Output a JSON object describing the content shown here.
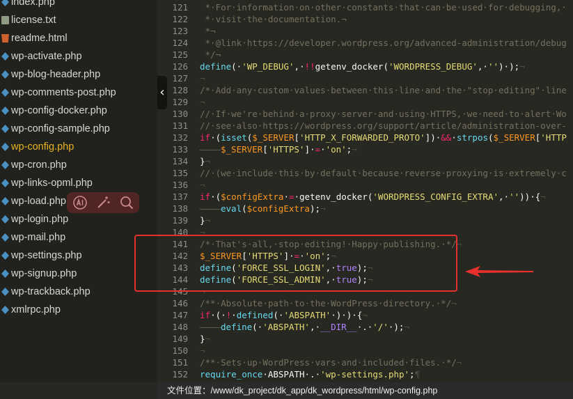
{
  "sidebar": {
    "files": [
      {
        "name": "index.php",
        "icon": "php-file-icon"
      },
      {
        "name": "license.txt",
        "icon": "txt-file-icon"
      },
      {
        "name": "readme.html",
        "icon": "html-file-icon"
      },
      {
        "name": "wp-activate.php",
        "icon": "php-file-icon"
      },
      {
        "name": "wp-blog-header.php",
        "icon": "php-file-icon"
      },
      {
        "name": "wp-comments-post.php",
        "icon": "php-file-icon"
      },
      {
        "name": "wp-config-docker.php",
        "icon": "php-file-icon"
      },
      {
        "name": "wp-config-sample.php",
        "icon": "php-file-icon"
      },
      {
        "name": "wp-config.php",
        "icon": "php-file-icon",
        "active": true
      },
      {
        "name": "wp-cron.php",
        "icon": "php-file-icon"
      },
      {
        "name": "wp-links-opml.php",
        "icon": "php-file-icon"
      },
      {
        "name": "wp-load.php",
        "icon": "php-file-icon"
      },
      {
        "name": "wp-login.php",
        "icon": "php-file-icon"
      },
      {
        "name": "wp-mail.php",
        "icon": "php-file-icon"
      },
      {
        "name": "wp-settings.php",
        "icon": "php-file-icon"
      },
      {
        "name": "wp-signup.php",
        "icon": "php-file-icon"
      },
      {
        "name": "wp-trackback.php",
        "icon": "php-file-icon"
      },
      {
        "name": "xmlrpc.php",
        "icon": "php-file-icon"
      }
    ],
    "collapse_glyph": "‹"
  },
  "float_toolbar": {
    "tools": [
      "ai-icon",
      "magic-wand-icon",
      "search-icon"
    ]
  },
  "editor": {
    "lines": [
      {
        "n": "121",
        "tokens": [
          [
            "ws",
            " "
          ],
          [
            "cm",
            "*·For·information·on·other·constants·that·can·be·used·for·debugging,·"
          ]
        ]
      },
      {
        "n": "122",
        "tokens": [
          [
            "ws",
            " "
          ],
          [
            "cm",
            "*·visit·the·documentation.¬"
          ]
        ]
      },
      {
        "n": "123",
        "tokens": [
          [
            "ws",
            " "
          ],
          [
            "cm",
            "*¬"
          ]
        ]
      },
      {
        "n": "124",
        "tokens": [
          [
            "ws",
            " "
          ],
          [
            "cm",
            "*·@link·https://developer.wordpress.org/advanced-administration/debug"
          ]
        ]
      },
      {
        "n": "125",
        "tokens": [
          [
            "ws",
            " "
          ],
          [
            "cm",
            "*/¬"
          ]
        ]
      },
      {
        "n": "126",
        "tokens": [
          [
            "fn",
            "define"
          ],
          [
            "",
            "(·"
          ],
          [
            "st",
            "'WP_DEBUG'"
          ],
          [
            "",
            ",·"
          ],
          [
            "kw",
            "!!"
          ],
          [
            "",
            "getenv_docker("
          ],
          [
            "st",
            "'WORDPRESS_DEBUG'"
          ],
          [
            "",
            ",·"
          ],
          [
            "st",
            "''"
          ],
          [
            "",
            ")·);"
          ],
          [
            "ws",
            "¬"
          ]
        ]
      },
      {
        "n": "127",
        "tokens": [
          [
            "ws",
            "¬"
          ]
        ]
      },
      {
        "n": "128",
        "tokens": [
          [
            "cm",
            "/*·Add·any·custom·values·between·this·line·and·the·\"stop·editing\"·line"
          ]
        ]
      },
      {
        "n": "129",
        "tokens": [
          [
            "ws",
            "¬"
          ]
        ]
      },
      {
        "n": "130",
        "tokens": [
          [
            "cm",
            "//·If·we're·behind·a·proxy·server·and·using·HTTPS,·we·need·to·alert·Wo"
          ]
        ]
      },
      {
        "n": "131",
        "tokens": [
          [
            "cm",
            "//·see·also·https://wordpress.org/support/article/administration-over-"
          ]
        ]
      },
      {
        "n": "132",
        "tokens": [
          [
            "kw",
            "if"
          ],
          [
            "",
            "·("
          ],
          [
            "fn",
            "isset"
          ],
          [
            "",
            "("
          ],
          [
            "vr",
            "$_SERVER"
          ],
          [
            "",
            "["
          ],
          [
            "st",
            "'HTTP_X_FORWARDED_PROTO'"
          ],
          [
            "",
            "])·"
          ],
          [
            "kw",
            "&&"
          ],
          [
            "",
            "·"
          ],
          [
            "fn",
            "strpos"
          ],
          [
            "",
            "("
          ],
          [
            "vr",
            "$_SERVER"
          ],
          [
            "",
            "["
          ],
          [
            "st",
            "'HTTP"
          ]
        ]
      },
      {
        "n": "133",
        "tokens": [
          [
            "tab",
            ""
          ],
          [
            "vr",
            "$_SERVER"
          ],
          [
            "",
            "["
          ],
          [
            "st",
            "'HTTPS'"
          ],
          [
            "",
            "]·"
          ],
          [
            "kw",
            "="
          ],
          [
            "",
            "·"
          ],
          [
            "st",
            "'on'"
          ],
          [
            "",
            ";"
          ],
          [
            "ws",
            "¬"
          ]
        ]
      },
      {
        "n": "134",
        "tokens": [
          [
            "",
            "}"
          ],
          [
            "ws",
            "¬"
          ]
        ]
      },
      {
        "n": "135",
        "tokens": [
          [
            "cm",
            "//·(we·include·this·by·default·because·reverse·proxying·is·extremely·c"
          ]
        ]
      },
      {
        "n": "136",
        "tokens": [
          [
            "ws",
            "¬"
          ]
        ]
      },
      {
        "n": "137",
        "tokens": [
          [
            "kw",
            "if"
          ],
          [
            "",
            "·("
          ],
          [
            "vr",
            "$configExtra"
          ],
          [
            "",
            "·"
          ],
          [
            "kw",
            "="
          ],
          [
            "",
            "·getenv_docker("
          ],
          [
            "st",
            "'WORDPRESS_CONFIG_EXTRA'"
          ],
          [
            "",
            ",·"
          ],
          [
            "st",
            "''"
          ],
          [
            "",
            "))·{"
          ],
          [
            "ws",
            "¬"
          ]
        ]
      },
      {
        "n": "138",
        "tokens": [
          [
            "tab",
            ""
          ],
          [
            "fn",
            "eval"
          ],
          [
            "",
            "("
          ],
          [
            "vr",
            "$configExtra"
          ],
          [
            "",
            ");"
          ],
          [
            "ws",
            "¬"
          ]
        ]
      },
      {
        "n": "139",
        "tokens": [
          [
            "",
            "}"
          ],
          [
            "ws",
            "¬"
          ]
        ]
      },
      {
        "n": "140",
        "tokens": [
          [
            "ws",
            "¬"
          ]
        ]
      },
      {
        "n": "141",
        "tokens": [
          [
            "cm",
            "/*·That's·all,·stop·editing!·Happy·publishing.·*/"
          ],
          [
            "ws",
            "¬"
          ]
        ]
      },
      {
        "n": "142",
        "tokens": [
          [
            "vr",
            "$_SERVER"
          ],
          [
            "",
            "["
          ],
          [
            "st",
            "'HTTPS'"
          ],
          [
            "",
            "]·"
          ],
          [
            "kw",
            "="
          ],
          [
            "",
            "·"
          ],
          [
            "st",
            "'on'"
          ],
          [
            "",
            ";"
          ],
          [
            "ws",
            "¬"
          ]
        ]
      },
      {
        "n": "143",
        "tokens": [
          [
            "fn",
            "define"
          ],
          [
            "",
            "("
          ],
          [
            "st",
            "'FORCE_SSL_LOGIN'"
          ],
          [
            "",
            ",·"
          ],
          [
            "cs",
            "true"
          ],
          [
            "",
            ");"
          ],
          [
            "ws",
            "¬"
          ]
        ]
      },
      {
        "n": "144",
        "tokens": [
          [
            "fn",
            "define"
          ],
          [
            "",
            "("
          ],
          [
            "st",
            "'FORCE_SSL_ADMIN'"
          ],
          [
            "",
            ",·"
          ],
          [
            "cs",
            "true"
          ],
          [
            "",
            ");"
          ],
          [
            "ws",
            "¬"
          ]
        ]
      },
      {
        "n": "145",
        "tokens": [
          [
            "ws",
            "¬"
          ]
        ]
      },
      {
        "n": "146",
        "tokens": [
          [
            "cm",
            "/**·Absolute·path·to·the·WordPress·directory.·*/"
          ],
          [
            "ws",
            "¬"
          ]
        ]
      },
      {
        "n": "147",
        "tokens": [
          [
            "kw",
            "if"
          ],
          [
            "",
            "·(·"
          ],
          [
            "kw",
            "!"
          ],
          [
            "",
            "·"
          ],
          [
            "fn",
            "defined"
          ],
          [
            "",
            "(·"
          ],
          [
            "st",
            "'ABSPATH'"
          ],
          [
            "",
            "·)·)·{"
          ],
          [
            "ws",
            "¬"
          ]
        ]
      },
      {
        "n": "148",
        "tokens": [
          [
            "tab",
            ""
          ],
          [
            "fn",
            "define"
          ],
          [
            "",
            "(·"
          ],
          [
            "st",
            "'ABSPATH'"
          ],
          [
            "",
            ",·"
          ],
          [
            "cs",
            "__DIR__"
          ],
          [
            "",
            "·.·"
          ],
          [
            "st",
            "'/'"
          ],
          [
            "",
            "·);"
          ],
          [
            "ws",
            "¬"
          ]
        ]
      },
      {
        "n": "149",
        "tokens": [
          [
            "",
            "}"
          ],
          [
            "ws",
            "¬"
          ]
        ]
      },
      {
        "n": "150",
        "tokens": [
          [
            "ws",
            "¬"
          ]
        ]
      },
      {
        "n": "151",
        "tokens": [
          [
            "cm",
            "/**·Sets·up·WordPress·vars·and·included·files.·*/"
          ],
          [
            "ws",
            "¬"
          ]
        ]
      },
      {
        "n": "152",
        "tokens": [
          [
            "fn",
            "require_once"
          ],
          [
            "",
            "·ABSPATH·.·"
          ],
          [
            "st",
            "'wp-settings.php'"
          ],
          [
            "",
            ";"
          ],
          [
            "ws",
            "¶"
          ]
        ]
      }
    ]
  },
  "statusbar": {
    "path_label": "文件位置：/www/dk_project/dk_app/dk_wordpress/html/wp-config.php"
  },
  "colors": {
    "annotation": "#e8302c",
    "active_file": "#e6b422"
  }
}
